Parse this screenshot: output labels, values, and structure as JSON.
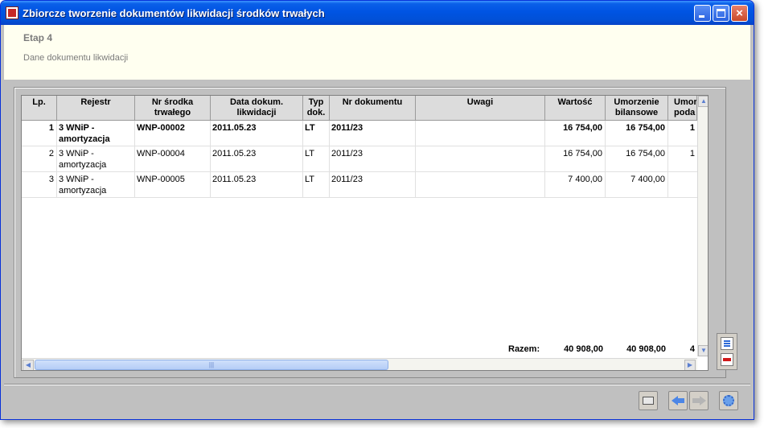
{
  "window": {
    "title": "Zbiorcze tworzenie dokumentów likwidacji środków trwałych"
  },
  "header": {
    "step": "Etap 4",
    "description": "Dane dokumentu likwidacji"
  },
  "table": {
    "columns": [
      {
        "key": "lp",
        "label": "Lp."
      },
      {
        "key": "rejestr",
        "label": "Rejestr"
      },
      {
        "key": "nr_st_1",
        "label": "Nr środka"
      },
      {
        "key": "nr_st_2",
        "label": "trwałego"
      },
      {
        "key": "data_1",
        "label": "Data dokum."
      },
      {
        "key": "data_2",
        "label": "likwidacji"
      },
      {
        "key": "typ_1",
        "label": "Typ"
      },
      {
        "key": "typ_2",
        "label": "dok."
      },
      {
        "key": "nr_dok",
        "label": "Nr dokumentu"
      },
      {
        "key": "uwagi",
        "label": "Uwagi"
      },
      {
        "key": "wartosc",
        "label": "Wartość"
      },
      {
        "key": "umb_1",
        "label": "Umorzenie"
      },
      {
        "key": "umb_2",
        "label": "bilansowe"
      },
      {
        "key": "ump_1",
        "label": "Umor"
      },
      {
        "key": "ump_2",
        "label": "poda"
      }
    ],
    "rows": [
      {
        "lp": "1",
        "rejestr_1": "3 WNiP -",
        "rejestr_2": "amortyzacja",
        "nr": "WNP-00002",
        "data": "2011.05.23",
        "typ": "LT",
        "nr_dok": "2011/23",
        "uwagi": "",
        "wartosc": "16 754,00",
        "umb": "16 754,00",
        "ump": "1"
      },
      {
        "lp": "2",
        "rejestr_1": "3 WNiP -",
        "rejestr_2": "amortyzacja",
        "nr": "WNP-00004",
        "data": "2011.05.23",
        "typ": "LT",
        "nr_dok": "2011/23",
        "uwagi": "",
        "wartosc": "16 754,00",
        "umb": "16 754,00",
        "ump": "1"
      },
      {
        "lp": "3",
        "rejestr_1": "3 WNiP -",
        "rejestr_2": "amortyzacja",
        "nr": "WNP-00005",
        "data": "2011.05.23",
        "typ": "LT",
        "nr_dok": "2011/23",
        "uwagi": "",
        "wartosc": "7 400,00",
        "umb": "7 400,00",
        "ump": ""
      }
    ],
    "totals": {
      "label": "Razem:",
      "wartosc": "40 908,00",
      "umb": "40 908,00",
      "ump": "4"
    }
  },
  "icons": {
    "app": "app-icon",
    "minimize": "minimize-icon",
    "maximize": "maximize-icon",
    "close": "close-icon",
    "add_doc": "document-edit-icon",
    "delete": "delete-row-icon",
    "print": "print-icon",
    "back": "arrow-left-icon",
    "next": "arrow-right-icon",
    "settings": "gear-icon"
  }
}
